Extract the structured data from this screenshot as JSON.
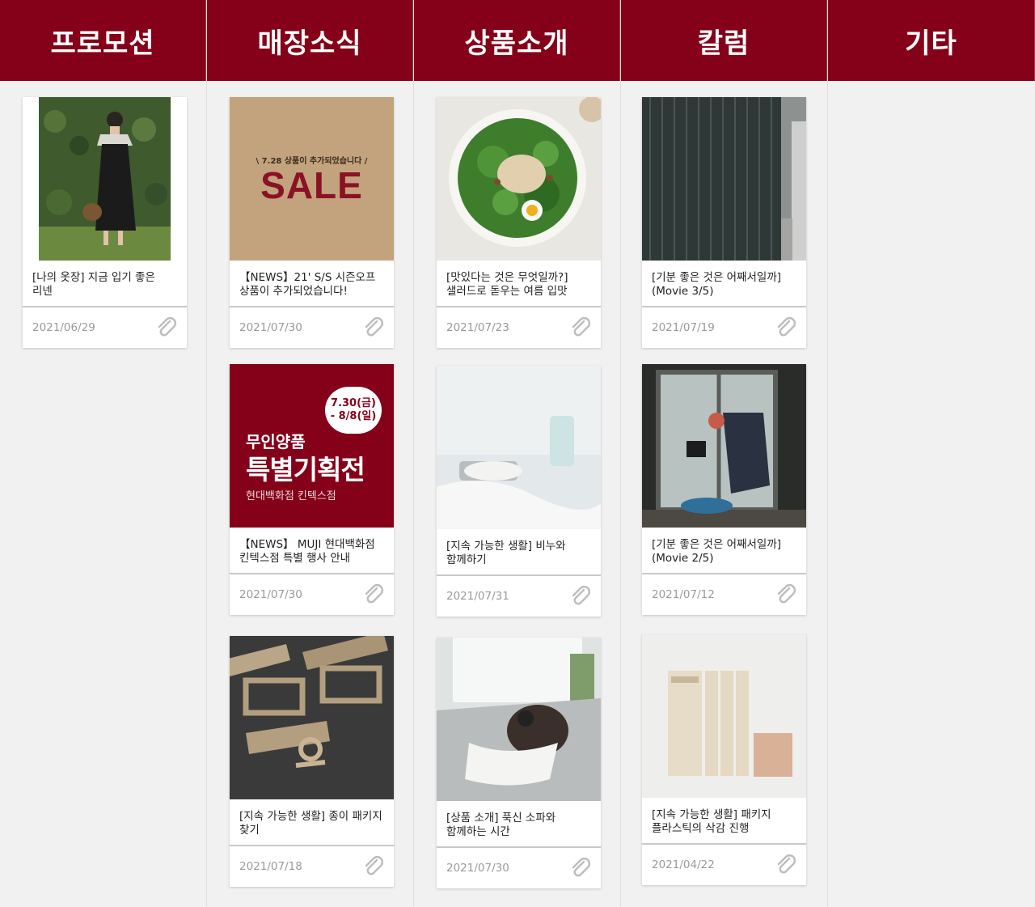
{
  "columns": [
    {
      "title": "프로모션"
    },
    {
      "title": "매장소식"
    },
    {
      "title": "상품소개"
    },
    {
      "title": "칼럼"
    },
    {
      "title": "기타"
    }
  ],
  "cards": {
    "promo_1": {
      "title": "[나의 옷장] 지금 입기 좋은\n리넨",
      "date": "2021/06/29"
    },
    "store_1": {
      "title": "【NEWS】21' S/S 시즌오프\n상품이 추가되었습니다!",
      "date": "2021/07/30",
      "art": {
        "sub": "\\  7.28 상품이 추가되었습니다  /",
        "big": "SALE"
      }
    },
    "store_2": {
      "title": "【NEWS】 MUJI 현대백화점\n킨텍스점 특별 행사 안내",
      "date": "2021/07/30",
      "art": {
        "bubble_1": "7.30(금)",
        "bubble_2": "- 8/8(일)",
        "line_1": "무인양품",
        "line_2": "특별기획전",
        "line_3": "현대백화점 킨텍스점"
      }
    },
    "store_3": {
      "title": "[지속 가능한 생활] 종이 패키지\n찾기",
      "date": "2021/07/18"
    },
    "product_1": {
      "title": "[맛있다는 것은 무엇일까?]\n샐러드로 돋우는 여름 입맛",
      "date": "2021/07/23"
    },
    "product_2": {
      "title": "[지속 가능한 생활] 비누와\n함께하기",
      "date": "2021/07/31"
    },
    "product_3": {
      "title": "[상품 소개] 푹신 소파와\n함께하는 시간",
      "date": "2021/07/30"
    },
    "column_1": {
      "title": "[기분 좋은 것은 어째서일까]\n(Movie 3/5)",
      "date": "2021/07/19"
    },
    "column_2": {
      "title": "[기분 좋은 것은 어째서일까]\n(Movie 2/5)",
      "date": "2021/07/12"
    },
    "column_3": {
      "title": "[지속 가능한 생활] 패키지\n플라스틱의 삭감 진행",
      "date": "2021/04/22"
    }
  },
  "icons": {
    "attachment": "paperclip-icon"
  },
  "colors": {
    "header_bg": "#850019",
    "board_bg": "#f1f1f1",
    "date_text": "#9a9a9a"
  }
}
